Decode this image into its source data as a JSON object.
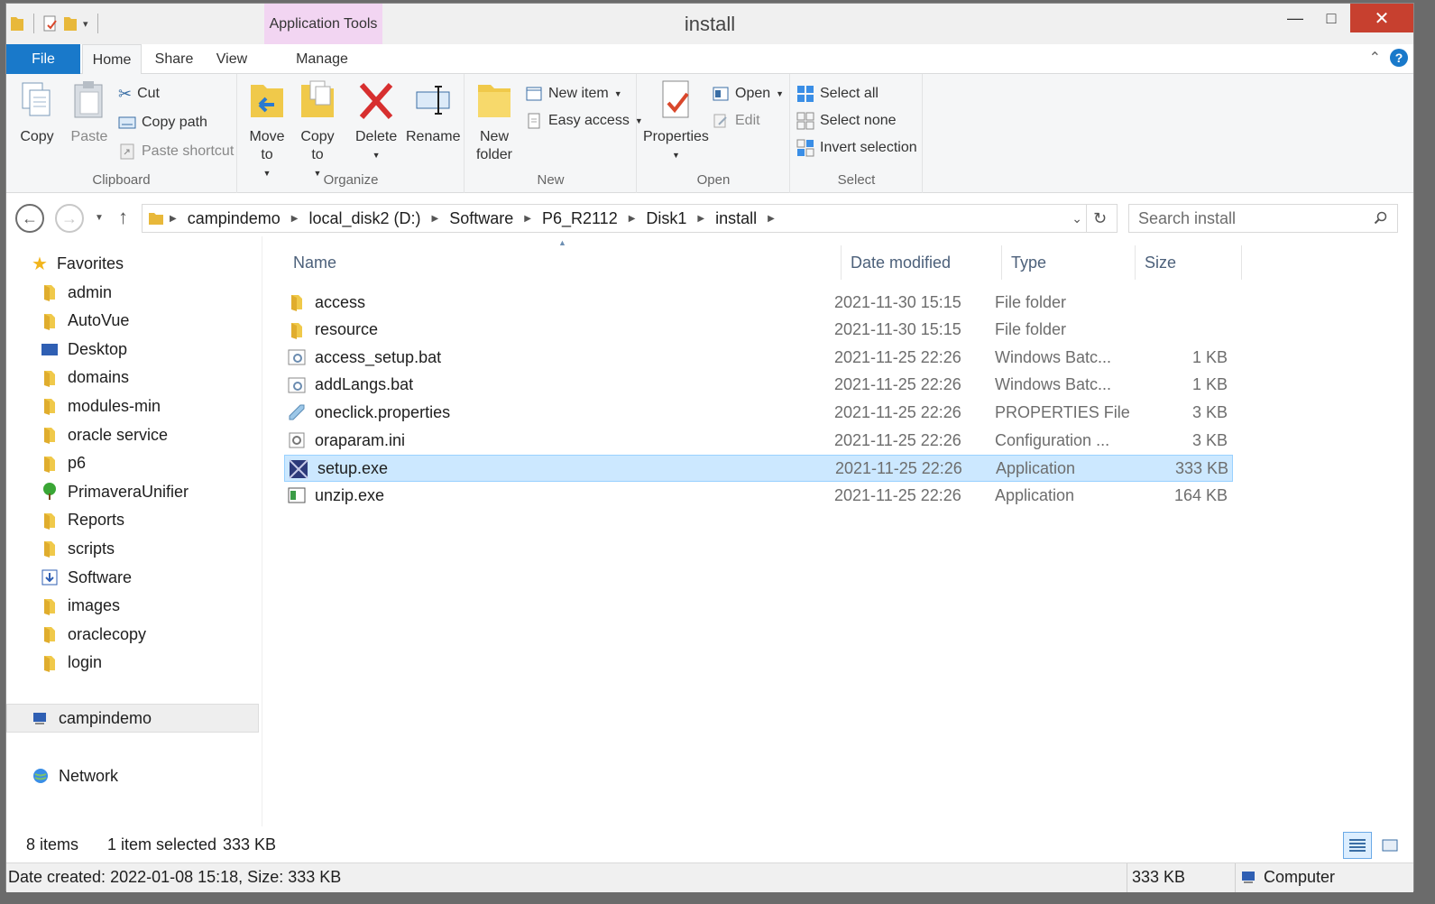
{
  "window": {
    "title": "install",
    "close": "✕",
    "maximize": "□",
    "minimize": "—"
  },
  "ribbon_tabs": {
    "file": "File",
    "home": "Home",
    "share": "Share",
    "view": "View",
    "manage": "Manage",
    "app_tools": "Application Tools"
  },
  "clipboard": {
    "copy": "Copy",
    "paste": "Paste",
    "cut": "Cut",
    "copy_path": "Copy path",
    "paste_shortcut": "Paste shortcut",
    "label": "Clipboard"
  },
  "organize": {
    "move_to": "Move to",
    "copy_to": "Copy to",
    "delete": "Delete",
    "rename": "Rename",
    "label": "Organize"
  },
  "new_group": {
    "new_folder": "New folder",
    "new_item": "New item",
    "easy_access": "Easy access",
    "label": "New"
  },
  "open_group": {
    "properties": "Properties",
    "open": "Open",
    "edit": "Edit",
    "label": "Open"
  },
  "select_group": {
    "select_all": "Select all",
    "select_none": "Select none",
    "invert": "Invert selection",
    "label": "Select"
  },
  "address": {
    "breadcrumbs": [
      "campindemo",
      "local_disk2 (D:)",
      "Software",
      "P6_R2112",
      "Disk1",
      "install"
    ]
  },
  "search": {
    "placeholder": "Search install"
  },
  "nav": {
    "favorites": "Favorites",
    "items": [
      "admin",
      "AutoVue",
      "Desktop",
      "domains",
      "modules-min",
      "oracle service",
      "p6",
      "PrimaveraUnifier",
      "Reports",
      "scripts",
      "Software",
      "images",
      "oraclecopy",
      "login"
    ],
    "computer": "campindemo",
    "network": "Network"
  },
  "columns": {
    "name": "Name",
    "date": "Date modified",
    "type": "Type",
    "size": "Size"
  },
  "files": [
    {
      "name": "access",
      "date": "2021-11-30 15:15",
      "type": "File folder",
      "size": ""
    },
    {
      "name": "resource",
      "date": "2021-11-30 15:15",
      "type": "File folder",
      "size": ""
    },
    {
      "name": "access_setup.bat",
      "date": "2021-11-25 22:26",
      "type": "Windows Batc...",
      "size": "1 KB"
    },
    {
      "name": "addLangs.bat",
      "date": "2021-11-25 22:26",
      "type": "Windows Batc...",
      "size": "1 KB"
    },
    {
      "name": "oneclick.properties",
      "date": "2021-11-25 22:26",
      "type": "PROPERTIES File",
      "size": "3 KB"
    },
    {
      "name": "oraparam.ini",
      "date": "2021-11-25 22:26",
      "type": "Configuration ...",
      "size": "3 KB"
    },
    {
      "name": "setup.exe",
      "date": "2021-11-25 22:26",
      "type": "Application",
      "size": "333 KB"
    },
    {
      "name": "unzip.exe",
      "date": "2021-11-25 22:26",
      "type": "Application",
      "size": "164 KB"
    }
  ],
  "status": {
    "count": "8 items",
    "selected": "1 item selected",
    "selected_size": "333 KB"
  },
  "details_bar": {
    "info": "Date created: 2022-01-08 15:18, Size: 333 KB",
    "size": "333 KB",
    "location": "Computer"
  },
  "colors": {
    "accent": "#1979ca",
    "selection": "#cce8ff",
    "app_tools": "#f2d5f2",
    "close": "#c7402f"
  }
}
